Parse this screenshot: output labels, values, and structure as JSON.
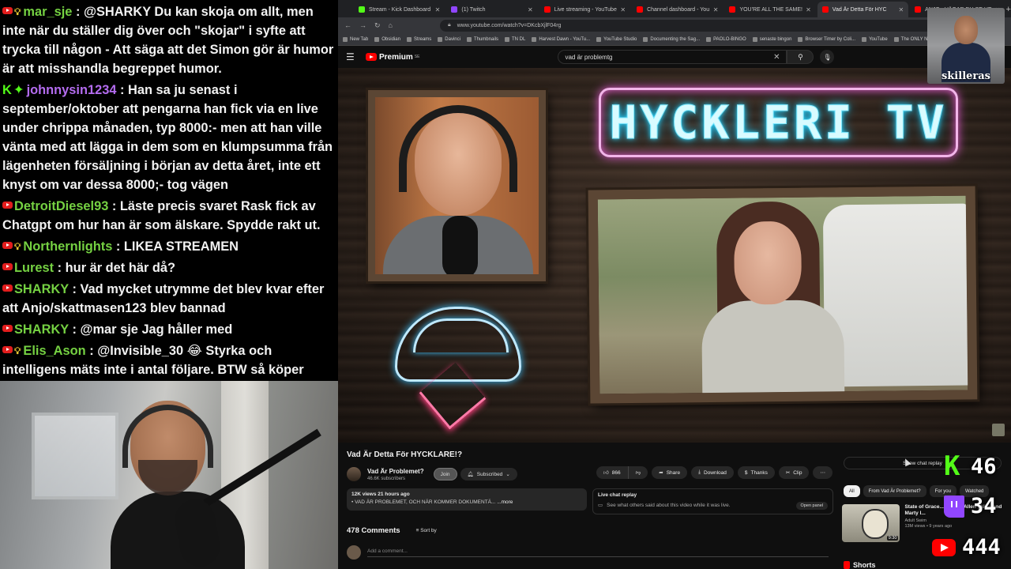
{
  "chat": {
    "messages": [
      {
        "platform": "youtube",
        "badge": "bulb",
        "user": "mar_sje",
        "text": ": @SHARKY Du kan skoja om allt, men inte när du ställer dig över och \"skojar\" i syfte att trycka till någon - Att säga att det Simon gör är humor är att misshandla begreppet humor."
      },
      {
        "platform": "kick",
        "badge": "gem",
        "user": "johnnysin1234",
        "text": ": Han sa ju senast i september/oktober att pengarna han fick via en live under chrippa månaden, typ 8000:- men att han ville vänta med att lägga in dem som en klumpsumma från lägenheten försäljning i början av detta året, inte ett knyst om var dessa 8000;- tog vägen"
      },
      {
        "platform": "youtube",
        "badge": "",
        "user": "DetroitDiesel93",
        "text": ": Läste precis svaret Rask fick av Chatgpt om hur han är som älskare. Spydde rakt ut."
      },
      {
        "platform": "youtube",
        "badge": "bulb",
        "user": "Northernlights",
        "text": ": LIKEA STREAMEN"
      },
      {
        "platform": "youtube",
        "badge": "",
        "user": "Lurest",
        "text": ": hur är det här då?"
      },
      {
        "platform": "youtube",
        "badge": "",
        "user": "SHARKY",
        "text": ": Vad mycket utrymme det blev kvar efter att Anjo/skattmasen123 blev bannad"
      },
      {
        "platform": "youtube",
        "badge": "",
        "user": "SHARKY",
        "text": ": @mar sje Jag håller med"
      },
      {
        "platform": "youtube",
        "badge": "bulb",
        "user": "Elis_Ason",
        "text": ": @Invisible_30 😂 Styrka och intelligens mäts inte i antal följare. BTW så köper Anjo följare"
      }
    ]
  },
  "browser": {
    "tabs": [
      {
        "label": "Stream - Kick Dashboard",
        "color": "#53fc18",
        "active": false
      },
      {
        "label": "(1) Twitch",
        "color": "#9146ff",
        "active": false
      },
      {
        "label": "Live streaming - YouTube",
        "color": "#ff0000",
        "active": false
      },
      {
        "label": "Channel dashboard - You",
        "color": "#ff0000",
        "active": false
      },
      {
        "label": "YOU'RE ALL THE SAME!",
        "color": "#ff0000",
        "active": false
      },
      {
        "label": "Vad Är Detta För HYC",
        "color": "#ff0000",
        "active": true
      },
      {
        "label": "ANJO - VÄGAR DU SE HE",
        "color": "#ff0000",
        "active": false
      }
    ],
    "new_tab": "+",
    "url": "www.youtube.com/watch?v=DKcbXjlF04rg",
    "bookmarks": [
      "New Tab",
      "Obsidian",
      "Streams",
      "Davinci",
      "Thumbnails",
      "TN DL",
      "Harvest Dawn - YouTu...",
      "YouTube Studio",
      "Documenting the Sag...",
      "PAOLO-BINGO",
      "senaste bingon",
      "Browser Timer by Coli...",
      "YouTube",
      "The ONLY NODE STR..."
    ]
  },
  "youtube": {
    "logo": "Premium",
    "logo_region": "SE",
    "search_value": "vad är problemtg",
    "video_neon_title": "HYCKLERI TV",
    "video_title": "Vad Är Detta För HYCKLARE!?",
    "channel_name": "Vad Är Problemet?",
    "subscribers": "46.6K subscribers",
    "join_label": "Join",
    "subscribed_label": "Subscribed",
    "likes": "866",
    "share_label": "Share",
    "download_label": "Download",
    "thanks_label": "Thanks",
    "clip_label": "Clip",
    "more_label": "⋯",
    "description_meta": "12K views  21 hours ago",
    "description_line": "• VAD ÄR PROBLEMET, OCH NÄR KOMMER DOKUMENTÄ...",
    "description_more": "...more",
    "live_chat_title": "Live chat replay",
    "live_chat_desc": "See what others said about this video while it was live.",
    "open_panel": "Open panel",
    "comments_count": "478 Comments",
    "sort_by": "Sort by",
    "add_comment": "Add a comment...",
    "show_chat_replay": "Show chat replay",
    "chips": [
      {
        "label": "All",
        "active": true
      },
      {
        "label": "From Vad Är Problemet?",
        "active": false
      },
      {
        "label": "For you",
        "active": false
      },
      {
        "label": "Watched",
        "active": false
      }
    ],
    "rec": {
      "title": "State of Grace... Fenton Allen | Nick and Marty I...",
      "channel": "Adult Swim",
      "meta": "13M views • 9 years ago",
      "duration": "9:30"
    },
    "shorts": "Shorts"
  },
  "overlay": {
    "cam_name": "skilleras",
    "viewers": {
      "kick": "46",
      "twitch": "34",
      "youtube": "444"
    }
  }
}
